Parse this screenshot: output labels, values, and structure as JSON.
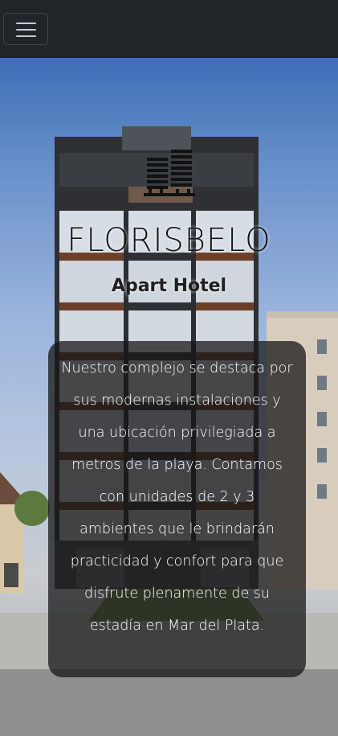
{
  "navbar": {
    "toggle_icon": "hamburger-menu-icon",
    "background": "#212529"
  },
  "hero": {
    "logo_icon": "building-logo-icon",
    "brand_name": "FLORISBELO",
    "subtitle": "Apart Hotel",
    "description": "Nuestro complejo se destaca por sus modernas instalaciones y una ubicación privilegiada a metros de la playa. Contamos con unidades de 2 y 3 ambientes que le brindarán practicidad y confort para que disfrute plenamente de su estadía en Mar del Plata.",
    "background_image": "apartment-building-photo",
    "card_color": "#161616"
  }
}
